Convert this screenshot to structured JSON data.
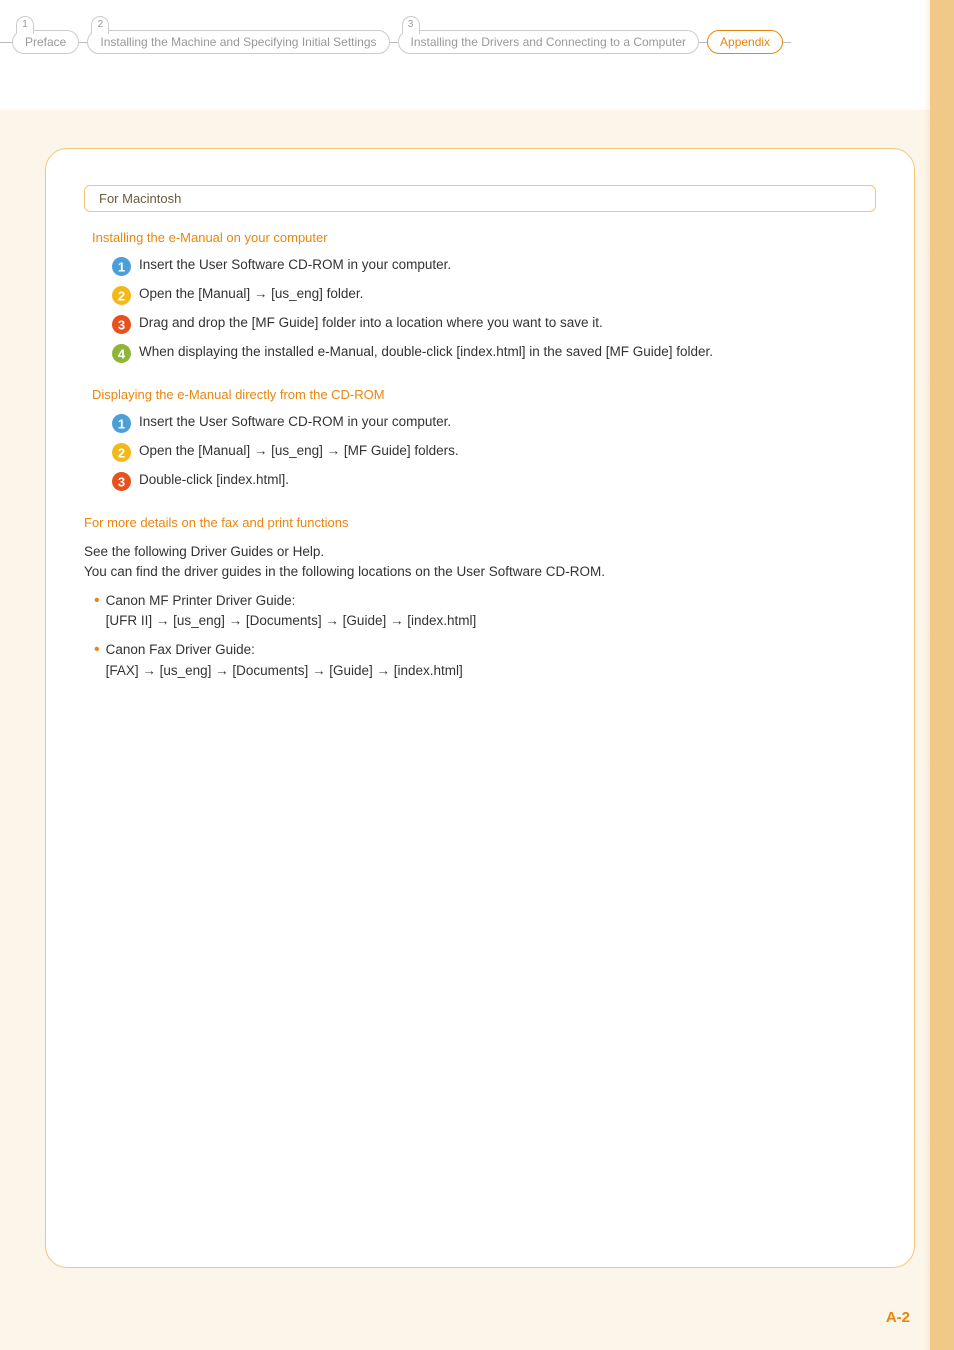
{
  "breadcrumb": {
    "items": [
      {
        "num": "1",
        "label": "Preface"
      },
      {
        "num": "2",
        "label": "Installing the Machine and Specifying Initial Settings"
      },
      {
        "num": "3",
        "label": "Installing the Drivers and Connecting to a Computer"
      },
      {
        "num": "",
        "label": "Appendix"
      }
    ]
  },
  "card": {
    "macTitle": "For Macintosh",
    "section1": {
      "heading": "Installing the e-Manual on your computer",
      "steps": [
        "Insert the User Software CD-ROM in your computer.",
        "Open the [Manual] → [us_eng] folder.",
        "Drag and drop the [MF Guide] folder into a location where you want to save it.",
        "When displaying the installed e-Manual, double-click [index.html] in the saved [MF Guide] folder."
      ]
    },
    "section2": {
      "heading": "Displaying the e-Manual directly from the CD-ROM",
      "steps": [
        "Insert the User Software CD-ROM in your computer.",
        "Open the [Manual] → [us_eng] → [MF Guide] folders.",
        "Double-click [index.html]."
      ]
    },
    "section3": {
      "heading": "For more details on the fax and print functions",
      "intro1": "See the following Driver Guides or Help.",
      "intro2": "You can find the driver guides in the following locations on the User Software CD-ROM.",
      "bullets": [
        {
          "title": "Canon MF Printer Driver Guide:",
          "path": "[UFR II] → [us_eng] → [Documents] → [Guide] → [index.html]"
        },
        {
          "title": "Canon Fax Driver Guide:",
          "path": "[FAX] → [us_eng] → [Documents] → [Guide] → [index.html]"
        }
      ]
    }
  },
  "pageNumber": "A-2",
  "colors": {
    "step1": "#4A9FD8",
    "step2": "#F5B819",
    "step3": "#E8501E",
    "step4": "#8FB536"
  }
}
